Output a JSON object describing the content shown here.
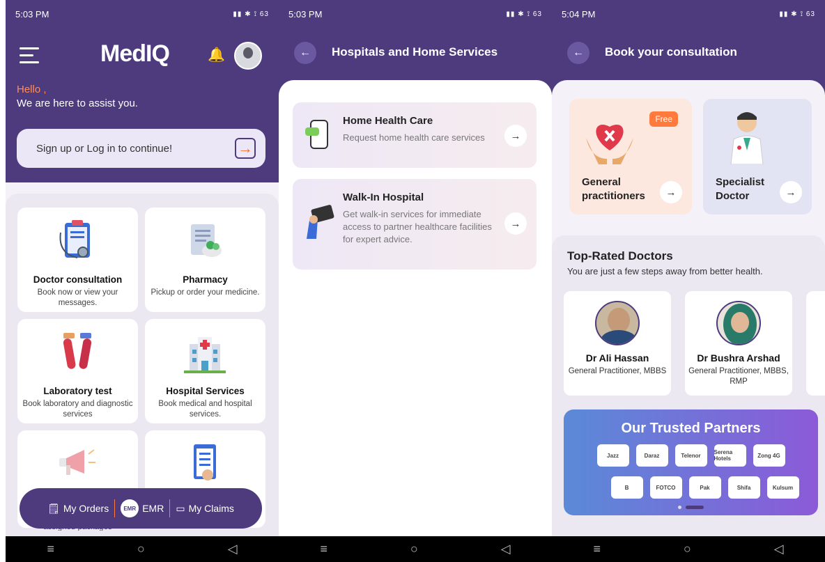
{
  "screens": [
    {
      "time": "5:03 PM",
      "battery": "63"
    },
    {
      "time": "5:03 PM",
      "battery": "63"
    },
    {
      "time": "5:04 PM",
      "battery": "63"
    }
  ],
  "home": {
    "logo": "MedIQ",
    "hello": "Hello ,",
    "assist": "We are here to assist you.",
    "login": "Sign up or Log in to continue!",
    "cards": [
      {
        "title": "Doctor consultation",
        "desc": "Book now or view your messages."
      },
      {
        "title": "Pharmacy",
        "desc": "Pickup or order your medicine."
      },
      {
        "title": "Laboratory test",
        "desc": "Book laboratory and diagnostic services"
      },
      {
        "title": "Hospital Services",
        "desc": "Book medical and hospital services."
      }
    ],
    "partial_text": "assigned packages",
    "bottom": {
      "orders": "My Orders",
      "emr": "EMR",
      "emr_badge": "EMR",
      "claims": "My Claims"
    }
  },
  "hospitals": {
    "title": "Hospitals and Home Services",
    "services": [
      {
        "title": "Home Health Care",
        "desc": "Request home health care services"
      },
      {
        "title": "Walk-In Hospital",
        "desc": "Get walk-in services for immediate access to partner healthcare facilities for expert advice."
      }
    ]
  },
  "booking": {
    "title": "Book your consultation",
    "gp": "General practitioners",
    "free": "Free",
    "specialist": "Specialist Doctor",
    "top_title": "Top-Rated Doctors",
    "top_sub": "You are just a few steps away from better health.",
    "doctors": [
      {
        "name": "Dr Ali Hassan",
        "qual": "General Practitioner, MBBS"
      },
      {
        "name": "Dr Bushra Arshad",
        "qual": "General Practitioner, MBBS, RMP"
      }
    ],
    "partners_title": "Our Trusted Partners",
    "partners_row1": [
      "Jazz",
      "Daraz",
      "Telenor",
      "Serena Hotels",
      "Zong 4G"
    ],
    "partners_row2": [
      "B",
      "FOTCO",
      "Pak",
      "Shifa",
      "Kulsum"
    ]
  },
  "colors": {
    "brand": "#4d3b7e",
    "accent": "#ff7a3c"
  }
}
